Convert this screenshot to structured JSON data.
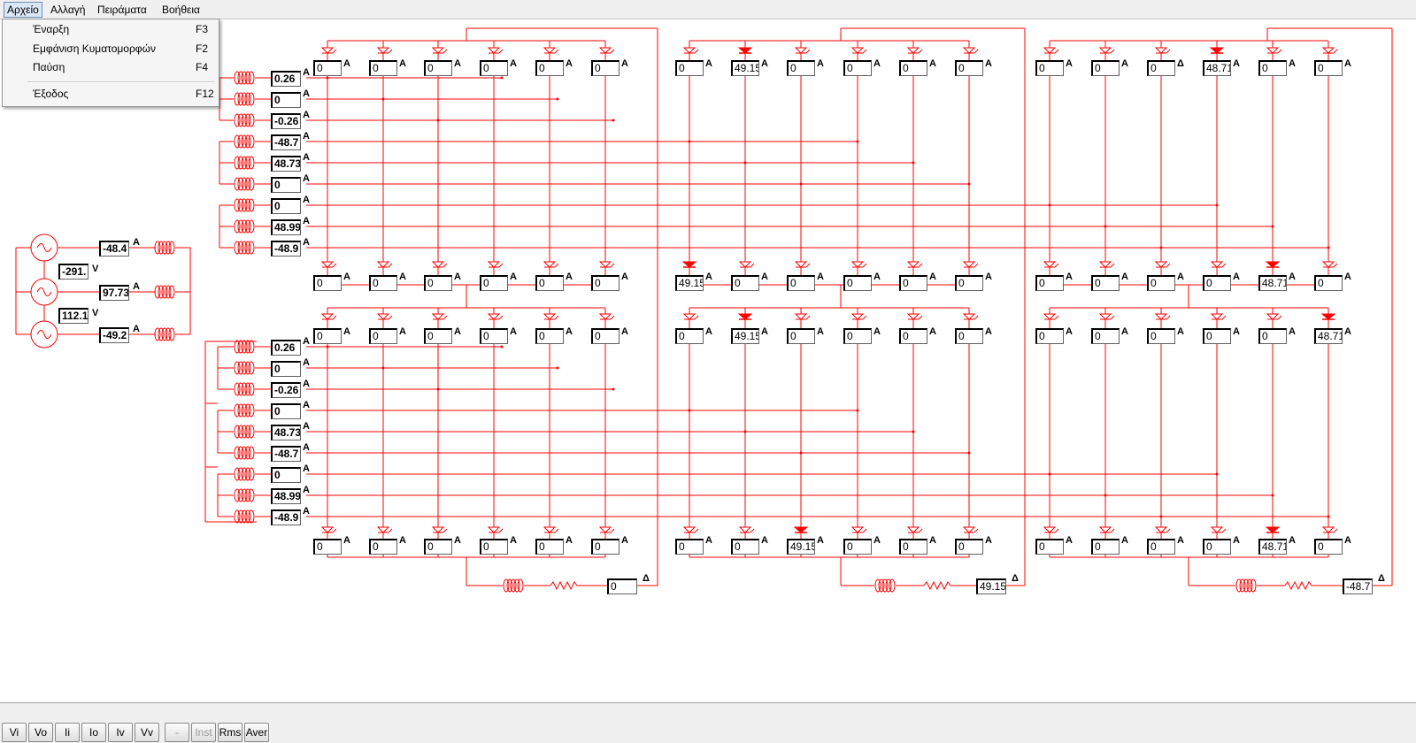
{
  "menubar": {
    "items": [
      "Αρχείο",
      "Αλλαγή",
      "Πειράματα",
      "Βοήθεια"
    ]
  },
  "file_menu": {
    "items": [
      {
        "label": "Έναρξη",
        "key": "F3"
      },
      {
        "label": "Εμφάνιση Κυματομορφών",
        "key": "F2"
      },
      {
        "label": "Παύση",
        "key": "F4"
      },
      {
        "label": "Έξοδος",
        "key": "F12"
      }
    ]
  },
  "toolbar": {
    "buttons": [
      "Vi",
      "Vo",
      "Ii",
      "Io",
      "Iv",
      "Vv",
      "-",
      "Inst",
      "Rms",
      "Aver"
    ]
  },
  "colors": {
    "circuit": "#ff0000",
    "active_thyristor": "#ff0000"
  },
  "source": {
    "currents": [
      "-48.4",
      "97.73",
      "-49.2"
    ],
    "line_voltages": [
      "-291.",
      "112.1"
    ],
    "current_unit": "A",
    "voltage_unit": "V"
  },
  "secondary_top": {
    "currents": [
      "0.26",
      "0",
      "-0.26",
      "-48.7",
      "48.73",
      "0",
      "0",
      "48.99",
      "-48.9"
    ],
    "unit": "A"
  },
  "secondary_bottom": {
    "currents": [
      "0.26",
      "0",
      "-0.26",
      "0",
      "48.73",
      "-48.7",
      "0",
      "48.99",
      "-48.9"
    ],
    "unit": "A"
  },
  "bridges": {
    "top_row": [
      {
        "upper": [
          "0",
          "0",
          "0",
          "0",
          "0",
          "0"
        ],
        "lower": [
          "0",
          "0",
          "0",
          "0",
          "0",
          "0"
        ]
      },
      {
        "upper": [
          "0",
          "49.15",
          "0",
          "0",
          "0",
          "0"
        ],
        "lower": [
          "49.15",
          "0",
          "0",
          "0",
          "0",
          "0"
        ]
      },
      {
        "upper": [
          "0",
          "0",
          "0",
          "48.71",
          "0",
          "0"
        ],
        "lower": [
          "0",
          "0",
          "0",
          "0",
          "48.71",
          "0"
        ]
      }
    ],
    "bottom_row": [
      {
        "upper": [
          "0",
          "0",
          "0",
          "0",
          "0",
          "0"
        ],
        "lower": [
          "0",
          "0",
          "0",
          "0",
          "0",
          "0"
        ]
      },
      {
        "upper": [
          "0",
          "49.15",
          "0",
          "0",
          "0",
          "0"
        ],
        "lower": [
          "0",
          "0",
          "49.15",
          "0",
          "0",
          "0"
        ]
      },
      {
        "upper": [
          "0",
          "0",
          "0",
          "0",
          "0",
          "48.71"
        ],
        "lower": [
          "0",
          "0",
          "0",
          "0",
          "48.71",
          "0"
        ]
      }
    ],
    "unit": "A",
    "unit_alt": "Δ"
  },
  "loads": [
    {
      "current": "0",
      "unit": "Δ"
    },
    {
      "current": "49.15",
      "unit": "Δ"
    },
    {
      "current": "-48.7",
      "unit": "Δ"
    }
  ]
}
